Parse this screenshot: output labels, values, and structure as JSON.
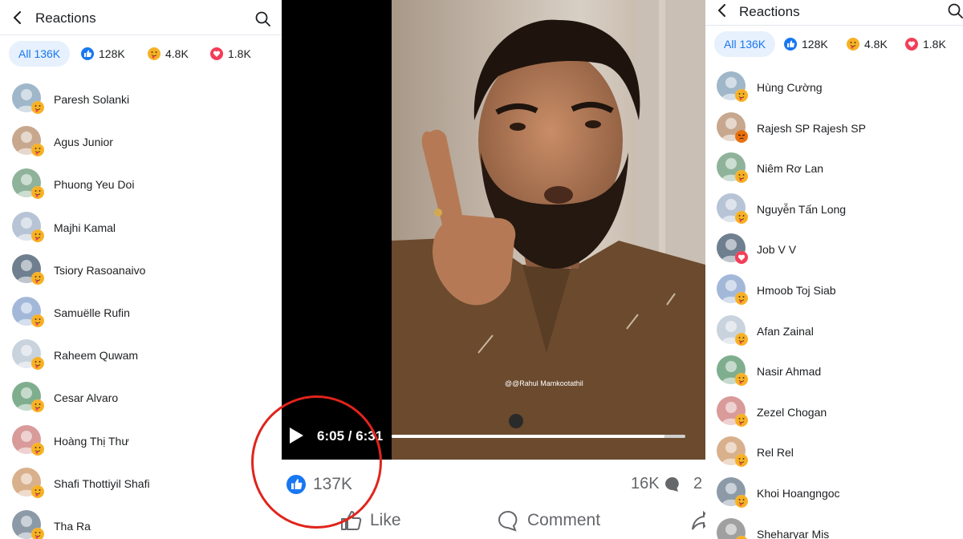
{
  "left_panel": {
    "title": "Reactions",
    "tabs": [
      {
        "label": "All 136K",
        "icon": null,
        "active": true
      },
      {
        "label": "128K",
        "icon": "like-icon",
        "active": false
      },
      {
        "label": "4.8K",
        "icon": "care-icon",
        "active": false
      },
      {
        "label": "1.8K",
        "icon": "love-icon",
        "active": false
      }
    ],
    "people": [
      {
        "name": "Paresh Solanki",
        "reaction": "care-icon"
      },
      {
        "name": "Agus Junior",
        "reaction": "care-icon"
      },
      {
        "name": "Phuong Yeu Doi",
        "reaction": "care-icon"
      },
      {
        "name": "Majhi Kamal",
        "reaction": "care-icon"
      },
      {
        "name": "Tsiory Rasoanaivo",
        "reaction": "care-icon"
      },
      {
        "name": "Samuëlle Rufin",
        "reaction": "care-icon"
      },
      {
        "name": "Raheem Quwam",
        "reaction": "care-icon"
      },
      {
        "name": "Cesar Alvaro",
        "reaction": "care-icon"
      },
      {
        "name": "Hoàng Thị Thư",
        "reaction": "care-icon"
      },
      {
        "name": "Shafi Thottiyil Shafi",
        "reaction": "care-icon"
      },
      {
        "name": "Tha Ra",
        "reaction": "care-icon"
      }
    ]
  },
  "right_panel": {
    "title": "Reactions",
    "tabs": [
      {
        "label": "All 136K",
        "icon": null,
        "active": true
      },
      {
        "label": "128K",
        "icon": "like-icon",
        "active": false
      },
      {
        "label": "4.8K",
        "icon": "care-icon",
        "active": false
      },
      {
        "label": "1.8K",
        "icon": "love-icon",
        "active": false
      }
    ],
    "people": [
      {
        "name": "Hùng Cường",
        "reaction": "care-icon"
      },
      {
        "name": "Rajesh SP Rajesh SP",
        "reaction": "angry-icon"
      },
      {
        "name": "Niêm Rơ Lan",
        "reaction": "care-icon"
      },
      {
        "name": "Nguyễn Tấn Long",
        "reaction": "care-icon"
      },
      {
        "name": "Job V V",
        "reaction": "love-icon"
      },
      {
        "name": "Hmoob Toj Siab",
        "reaction": "care-icon"
      },
      {
        "name": "Afan Zainal",
        "reaction": "care-icon"
      },
      {
        "name": "Nasir Ahmad",
        "reaction": "care-icon"
      },
      {
        "name": "Zezel Chogan",
        "reaction": "care-icon"
      },
      {
        "name": "Rel Rel",
        "reaction": "care-icon"
      },
      {
        "name": "Khoi Hoangngoc",
        "reaction": "care-icon"
      },
      {
        "name": "Sheharyar Mis",
        "reaction": "care-icon"
      }
    ]
  },
  "video": {
    "time": "6:05 / 6:31",
    "progress": 0.93,
    "watermark": "@@Rahul Mamkootathil"
  },
  "engagement": {
    "likes": "137K",
    "comments": "16K",
    "shares": "2",
    "like_label": "Like",
    "comment_label": "Comment"
  },
  "colors": {
    "accent": "#1877f2",
    "tab_active_bg": "#e7f0fd",
    "highlight_circle": "#e0241c",
    "love": "#f33e58",
    "care": "#f7b125",
    "angry": "#e9710f"
  }
}
